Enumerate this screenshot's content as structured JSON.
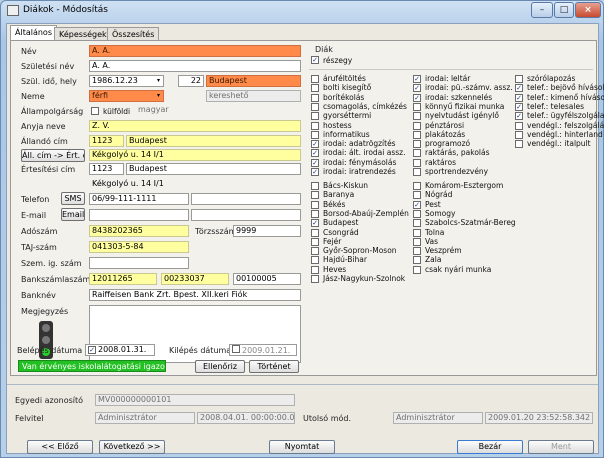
{
  "window": {
    "title": "Diákok - Módosítás"
  },
  "tabs": [
    "Általános",
    "Képességek",
    "Összesítés"
  ],
  "labels": {
    "nev": "Név",
    "szuletesi_nev": "Születési név",
    "szul_ido_hely": "Szül. idő, hely",
    "neme": "Neme",
    "allampolgarsag": "Állampolgárság",
    "anyja_neve": "Anyja neve",
    "allando_cim": "Állandó cím",
    "ertesitesi_cim": "Értesítési cím",
    "telefon": "Telefon",
    "email": "E-mail",
    "adoszam": "Adószám",
    "taj": "TAJ-szám",
    "szem_ig": "Szem. ig. szám",
    "bankszamla": "Bankszámlaszám",
    "banknev": "Banknév",
    "megjegyzes": "Megjegyzés",
    "belepes": "Belépés dátuma",
    "kilepes": "Kilépés dátuma",
    "torzsszam": "Törzsszám",
    "kulfoldi": "külföldi",
    "diak": "Diák",
    "reszegy": "részegy"
  },
  "values": {
    "nev": "A. A.",
    "szuletesi_nev": "A. A.",
    "szul_datum": "1986.12.23",
    "szul_kod": "22",
    "szul_hely": "Budapest",
    "neme": "férfi",
    "neme_ext": "kereshető",
    "allampolg": "magyar",
    "anyja_neve": "Z. V.",
    "allando_irsz": "1123",
    "allando_varos": "Budapest",
    "allando_utca": "Kékgolyó u. 14 I/1",
    "ert_irsz": "1123",
    "ert_varos": "Budapest",
    "ert_utca": "Kékgolyó u. 14 I/1",
    "telefon": "06/99-111-1111",
    "adoszam": "8438202365",
    "torzsszam": "9999",
    "taj": "041303-5-84",
    "bank1": "12011265",
    "bank2": "00233037",
    "bank3": "00100005",
    "banknev": "Raiffeisen Bank Zrt. Bpest. XII.keri Fiók",
    "belepes": "2008.01.31.",
    "kilepes": "2009.01.21."
  },
  "buttons": {
    "sms": "SMS",
    "email": "Email",
    "copy_addr": "Áll. cím -> Ért. cím",
    "ellenoriz": "Ellenőriz",
    "tortenet": "Történet",
    "prev": "<< Előző",
    "next": "Következő >>",
    "print": "Nyomtat",
    "close": "Bezár",
    "save": "Ment"
  },
  "status": "Van érvényes iskolalátogatási igazolása!",
  "footer": {
    "egyedi_label": "Egyedi azonosító",
    "egyedi_value": "MV000000000101",
    "felvitel_label": "Felvitel",
    "felvitel_user": "Adminisztrátor",
    "felvitel_date": "2008.04.01. 00:00:00.00",
    "utolso_label": "Utolsó mód.",
    "utolso_user": "Adminisztrátor",
    "utolso_date": "2009.01.20 23:52:58.342"
  },
  "skills_col1": [
    {
      "t": "áruféltöltés",
      "c": false
    },
    {
      "t": "bolti kisegítő",
      "c": false
    },
    {
      "t": "borítékolás",
      "c": false
    },
    {
      "t": "csomagolás, címkézés",
      "c": false
    },
    {
      "t": "gyorséttermi",
      "c": false
    },
    {
      "t": "hostess",
      "c": false
    },
    {
      "t": "informatikus",
      "c": false
    },
    {
      "t": "irodai: adatrögzítés",
      "c": true
    },
    {
      "t": "irodai: ált. irodai assz.",
      "c": true
    },
    {
      "t": "irodai: fénymásolás",
      "c": true
    },
    {
      "t": "irodai: iratrendezés",
      "c": true
    }
  ],
  "skills_col2": [
    {
      "t": "irodai: leltár",
      "c": true
    },
    {
      "t": "irodai: pü.-számv. assz.",
      "c": true
    },
    {
      "t": "irodai: szkennelés",
      "c": true
    },
    {
      "t": "könnyű fizikai munka",
      "c": false
    },
    {
      "t": "nyelvtudást igénylő",
      "c": false
    },
    {
      "t": "pénztárosi",
      "c": false
    },
    {
      "t": "plakátozás",
      "c": false
    },
    {
      "t": "programozó",
      "c": false
    },
    {
      "t": "raktárás, pakolás",
      "c": false
    },
    {
      "t": "raktáros",
      "c": false
    },
    {
      "t": "sportrendezvény",
      "c": false
    }
  ],
  "skills_col3": [
    {
      "t": "szórólapozás",
      "c": false
    },
    {
      "t": "telef.: bejövő hívások",
      "c": true
    },
    {
      "t": "telef.: kimenő hívások",
      "c": true
    },
    {
      "t": "telef.: telesales",
      "c": true
    },
    {
      "t": "telef.: ügyfélszolgálat",
      "c": true
    },
    {
      "t": "vendégl.: felszolgálás",
      "c": false
    },
    {
      "t": "vendégl.: hinterland",
      "c": false
    },
    {
      "t": "vendégl.: italpult",
      "c": false
    }
  ],
  "counties_col1": [
    {
      "t": "Bács-Kiskun",
      "c": false
    },
    {
      "t": "Baranya",
      "c": false
    },
    {
      "t": "Békés",
      "c": false
    },
    {
      "t": "Borsod-Abaúj-Zemplén",
      "c": false
    },
    {
      "t": "Budapest",
      "c": true
    },
    {
      "t": "Csongrád",
      "c": false
    },
    {
      "t": "Fejér",
      "c": false
    },
    {
      "t": "Győr-Sopron-Moson",
      "c": false
    },
    {
      "t": "Hajdú-Bihar",
      "c": false
    },
    {
      "t": "Heves",
      "c": false
    },
    {
      "t": "Jász-Nagykun-Szolnok",
      "c": false
    }
  ],
  "counties_col2": [
    {
      "t": "Komárom-Esztergom",
      "c": false
    },
    {
      "t": "Nógrád",
      "c": false
    },
    {
      "t": "Pest",
      "c": true
    },
    {
      "t": "Somogy",
      "c": false
    },
    {
      "t": "Szabolcs-Szatmár-Bereg",
      "c": false
    },
    {
      "t": "Tolna",
      "c": false
    },
    {
      "t": "Vas",
      "c": false
    },
    {
      "t": "Veszprém",
      "c": false
    },
    {
      "t": "Zala",
      "c": false
    },
    {
      "t": "csak nyári munka",
      "c": false
    }
  ],
  "colors": {
    "orange": "#ff8a4a",
    "yellow": "#ffffa0",
    "status_green": "#22c022"
  }
}
